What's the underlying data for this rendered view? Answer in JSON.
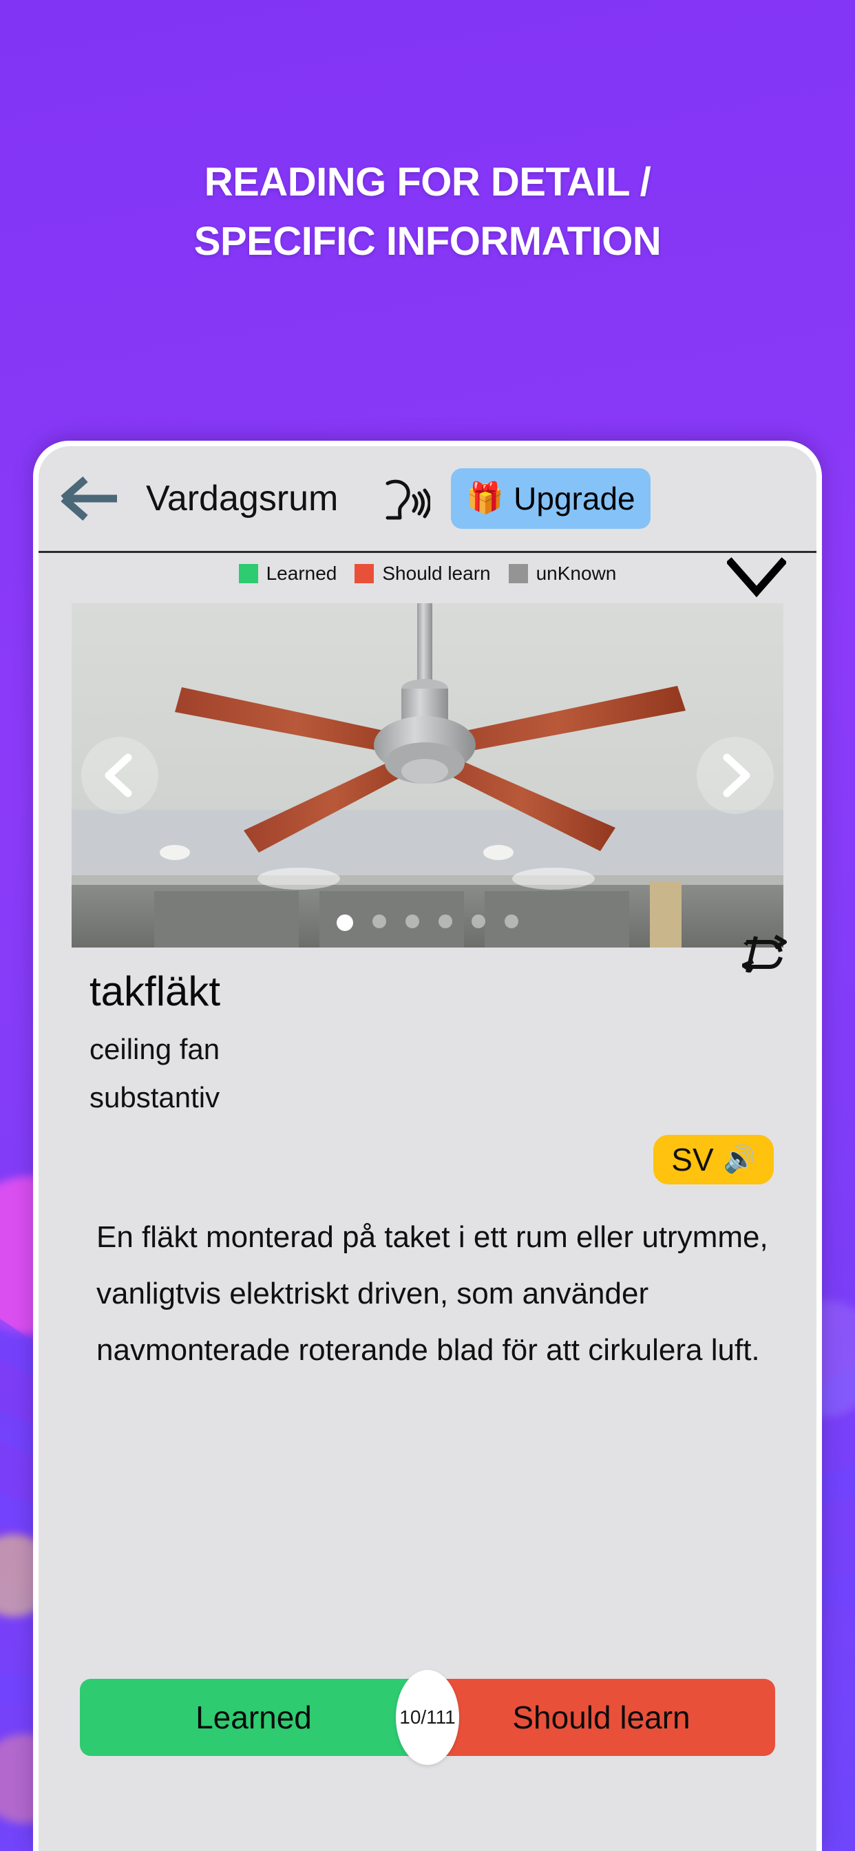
{
  "headline": {
    "line1": "READING FOR DETAIL /",
    "line2": "SPECIFIC INFORMATION"
  },
  "colors": {
    "background_purple": "#8234f5",
    "learned_green": "#2ecb71",
    "should_learn_red": "#e8503a",
    "unknown_gray": "#949494",
    "upgrade_blue": "#85c2f7",
    "sv_yellow": "#ffc20e"
  },
  "appbar": {
    "back_icon": "arrow-left-icon",
    "title": "Vardagsrum",
    "speak_icon": "speaking-head-icon",
    "upgrade": {
      "icon": "gift-icon",
      "glyph": "🎁",
      "label": "Upgrade"
    }
  },
  "legend": {
    "items": [
      {
        "label": "Learned",
        "color": "#2ecb71"
      },
      {
        "label": "Should learn",
        "color": "#e8503a"
      },
      {
        "label": "unKnown",
        "color": "#949494"
      }
    ],
    "collapse_icon": "chevron-down-icon"
  },
  "carousel": {
    "prev_icon": "chevron-left-icon",
    "next_icon": "chevron-right-icon",
    "dot_count": 6,
    "active_dot": 1
  },
  "shuffle": {
    "icon": "shuffle-icon"
  },
  "word": {
    "headword": "takfläkt",
    "translation": "ceiling fan",
    "part_of_speech": "substantiv"
  },
  "audio": {
    "language_code": "SV",
    "speaker_icon": "speaker-icon",
    "speaker_glyph": "🔊"
  },
  "definition": "En fläkt monterad på taket i ett rum eller utrymme, vanligtvis elektriskt driven, som använder navmonterade roterande blad för att cirkulera luft.",
  "actions": {
    "learned_label": "Learned",
    "should_learn_label": "Should learn",
    "progress": "10/111"
  }
}
